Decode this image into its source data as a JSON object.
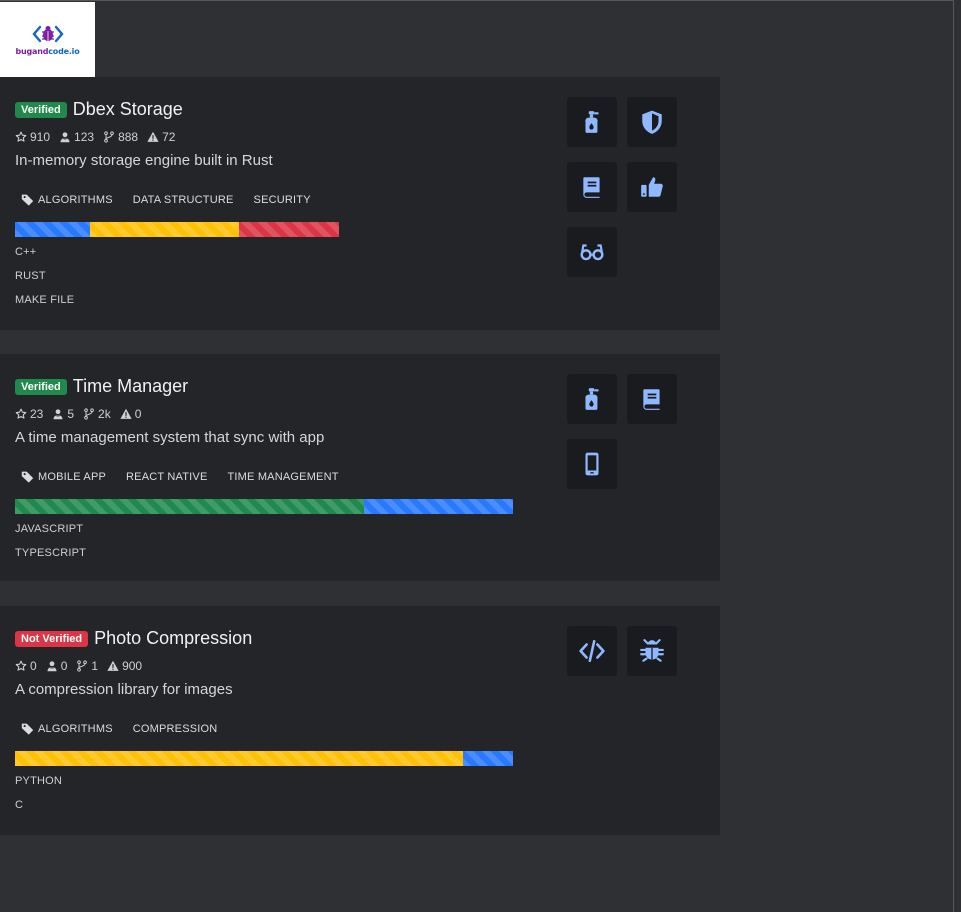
{
  "logo": {
    "text_part1": "bugand",
    "text_part2": "code.io"
  },
  "colors": {
    "blue": "#2979ff",
    "yellow": "#ffc107",
    "red": "#dc3545",
    "green": "#1f8a4c",
    "icon": "#8fb8ff"
  },
  "projects": [
    {
      "badge": "Verified",
      "verified": true,
      "title": "Dbex Storage",
      "stars": "910",
      "contributors": "123",
      "forks": "888",
      "issues": "72",
      "description": "In-memory storage engine built in Rust",
      "tags": [
        "ALGORITHMS",
        "DATA STRUCTURE",
        "SECURITY"
      ],
      "languages": [
        "C++",
        "RUST",
        "MAKE FILE"
      ],
      "language_shares": [
        0.231,
        0.461,
        0.308
      ],
      "language_colors": [
        "#2979ff",
        "#ffc107",
        "#dc3545"
      ],
      "icons": [
        "sanitizer-icon",
        "shield-icon",
        "book-icon",
        "thumbs-up-icon",
        "glasses-icon"
      ]
    },
    {
      "badge": "Verified",
      "verified": true,
      "title": "Time Manager",
      "stars": "23",
      "contributors": "5",
      "forks": "2k",
      "issues": "0",
      "description": "A time management system that sync with app",
      "tags": [
        "MOBILE APP",
        "REACT NATIVE",
        "TIME MANAGEMENT"
      ],
      "languages": [
        "JAVASCRIPT",
        "TYPESCRIPT"
      ],
      "language_shares": [
        0.7,
        0.3
      ],
      "language_colors": [
        "#1f8a4c",
        "#2979ff"
      ],
      "icons": [
        "sanitizer-icon",
        "book-icon",
        "mobile-phone-icon"
      ]
    },
    {
      "badge": "Not Verified",
      "verified": false,
      "title": "Photo Compression",
      "stars": "0",
      "contributors": "0",
      "forks": "1",
      "issues": "900",
      "description": "A compression library for images",
      "tags": [
        "ALGORITHMS",
        "COMPRESSION"
      ],
      "languages": [
        "PYTHON",
        "C"
      ],
      "language_shares": [
        0.9,
        0.1
      ],
      "language_colors": [
        "#ffc107",
        "#2979ff"
      ],
      "icons": [
        "code-icon",
        "bug-icon"
      ]
    }
  ]
}
